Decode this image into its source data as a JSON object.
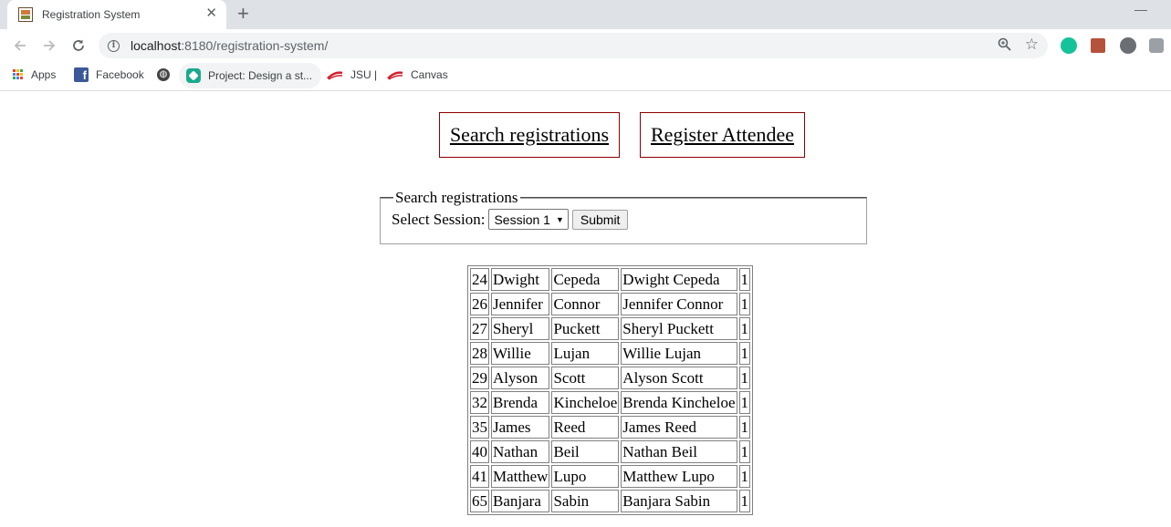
{
  "browser": {
    "tab_title": "Registration System",
    "url_host": "localhost",
    "url_rest": ":8180/registration-system/",
    "bookmarks": [
      "Apps",
      "Facebook",
      "Project: Design a st...",
      "JSU |",
      "Canvas"
    ]
  },
  "nav": {
    "search_label": "Search registrations",
    "register_label": "Register Attendee"
  },
  "search_form": {
    "legend": "Search registrations",
    "select_label": "Select Session:",
    "selected_session": "Session 1",
    "submit_label": "Submit"
  },
  "results": [
    {
      "id": "24",
      "first": "Dwight",
      "last": "Cepeda",
      "full": "Dwight Cepeda",
      "session": "1"
    },
    {
      "id": "26",
      "first": "Jennifer",
      "last": "Connor",
      "full": "Jennifer Connor",
      "session": "1"
    },
    {
      "id": "27",
      "first": "Sheryl",
      "last": "Puckett",
      "full": "Sheryl Puckett",
      "session": "1"
    },
    {
      "id": "28",
      "first": "Willie",
      "last": "Lujan",
      "full": "Willie Lujan",
      "session": "1"
    },
    {
      "id": "29",
      "first": "Alyson",
      "last": "Scott",
      "full": "Alyson Scott",
      "session": "1"
    },
    {
      "id": "32",
      "first": "Brenda",
      "last": "Kincheloe",
      "full": "Brenda Kincheloe",
      "session": "1"
    },
    {
      "id": "35",
      "first": "James",
      "last": "Reed",
      "full": "James Reed",
      "session": "1"
    },
    {
      "id": "40",
      "first": "Nathan",
      "last": "Beil",
      "full": "Nathan Beil",
      "session": "1"
    },
    {
      "id": "41",
      "first": "Matthew",
      "last": "Lupo",
      "full": "Matthew Lupo",
      "session": "1"
    },
    {
      "id": "65",
      "first": "Banjara",
      "last": "Sabin",
      "full": "Banjara Sabin",
      "session": "1"
    }
  ]
}
